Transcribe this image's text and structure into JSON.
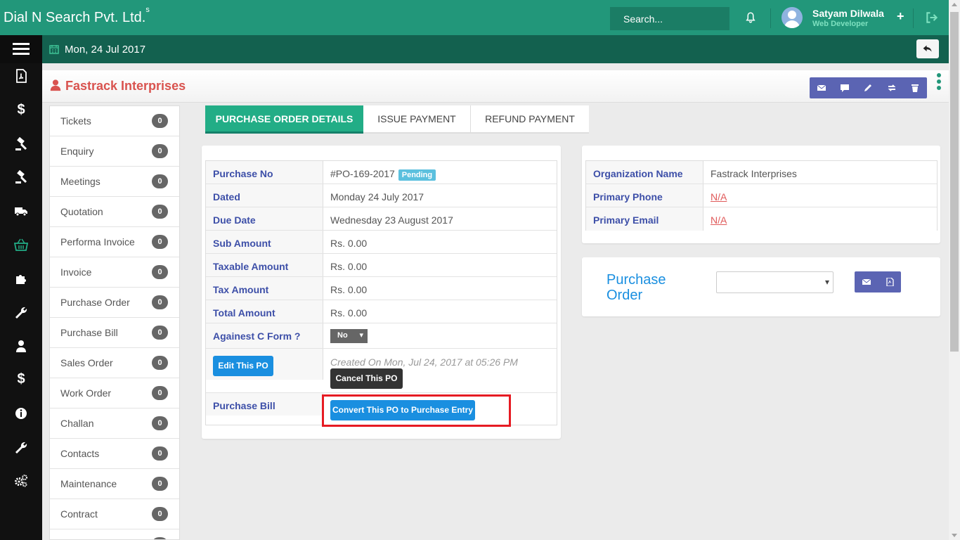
{
  "topbar": {
    "brand": "Dial N Search Pvt. Ltd.",
    "brand_sup": "s",
    "search_placeholder": "Search...",
    "user_name": "Satyam Dilwala",
    "user_role": "Web Developer",
    "plus": "+",
    "bg_color": "#22977a"
  },
  "subbar": {
    "date": "Mon, 24 Jul 2017"
  },
  "header": {
    "title": "Fastrack Interprises"
  },
  "sidebar_icons": [
    "pdf-icon",
    "dollar-icon",
    "gavel-icon",
    "gavel-icon",
    "truck-icon",
    "basket-icon",
    "puzzle-icon",
    "wrench-icon",
    "user-icon",
    "dollar-icon",
    "info-icon",
    "wrench-icon",
    "gears-icon"
  ],
  "left_list": [
    {
      "label": "Tickets",
      "count": "0"
    },
    {
      "label": "Enquiry",
      "count": "0"
    },
    {
      "label": "Meetings",
      "count": "0"
    },
    {
      "label": "Quotation",
      "count": "0"
    },
    {
      "label": "Performa Invoice",
      "count": "0"
    },
    {
      "label": "Invoice",
      "count": "0"
    },
    {
      "label": "Purchase Order",
      "count": "0"
    },
    {
      "label": "Purchase Bill",
      "count": "0"
    },
    {
      "label": "Sales Order",
      "count": "0"
    },
    {
      "label": "Work Order",
      "count": "0"
    },
    {
      "label": "Challan",
      "count": "0"
    },
    {
      "label": "Contacts",
      "count": "0"
    },
    {
      "label": "Maintenance",
      "count": "0"
    },
    {
      "label": "Contract",
      "count": "0"
    }
  ],
  "tabs": [
    "PURCHASE ORDER DETAILS",
    "ISSUE PAYMENT",
    "REFUND PAYMENT"
  ],
  "po": {
    "purchase_no_label": "Purchase No",
    "purchase_no": "#PO-169-2017",
    "status": "Pending",
    "dated_label": "Dated",
    "dated": "Monday 24 July 2017",
    "due_label": "Due Date",
    "due": "Wednesday 23 August 2017",
    "sub_label": "Sub Amount",
    "sub": "Rs. 0.00",
    "taxable_label": "Taxable Amount",
    "taxable": "Rs. 0.00",
    "tax_label": "Tax Amount",
    "tax": "Rs. 0.00",
    "total_label": "Total Amount",
    "total": "Rs. 0.00",
    "cform_label": "Againest C Form ?",
    "cform_value": "No",
    "edit_button": "Edit This PO",
    "created": "Created On Mon, Jul 24, 2017 at 05:26 PM",
    "cancel_button": "Cancel This PO",
    "bill_label": "Purchase Bill",
    "convert_button": "Convert This PO to Purchase Entry"
  },
  "org": {
    "name_label": "Organization Name",
    "name": "Fastrack Interprises",
    "phone_label": "Primary Phone",
    "phone": "N/A",
    "email_label": "Primary Email",
    "email": "N/A"
  },
  "po_panel": {
    "title": "Purchase Order"
  },
  "colors": {
    "accent": "#22977a",
    "tab_active": "#22ad86",
    "label_blue": "#3d4fa8",
    "action_purple": "#5b64b3",
    "highlight_red": "#e61b23"
  }
}
